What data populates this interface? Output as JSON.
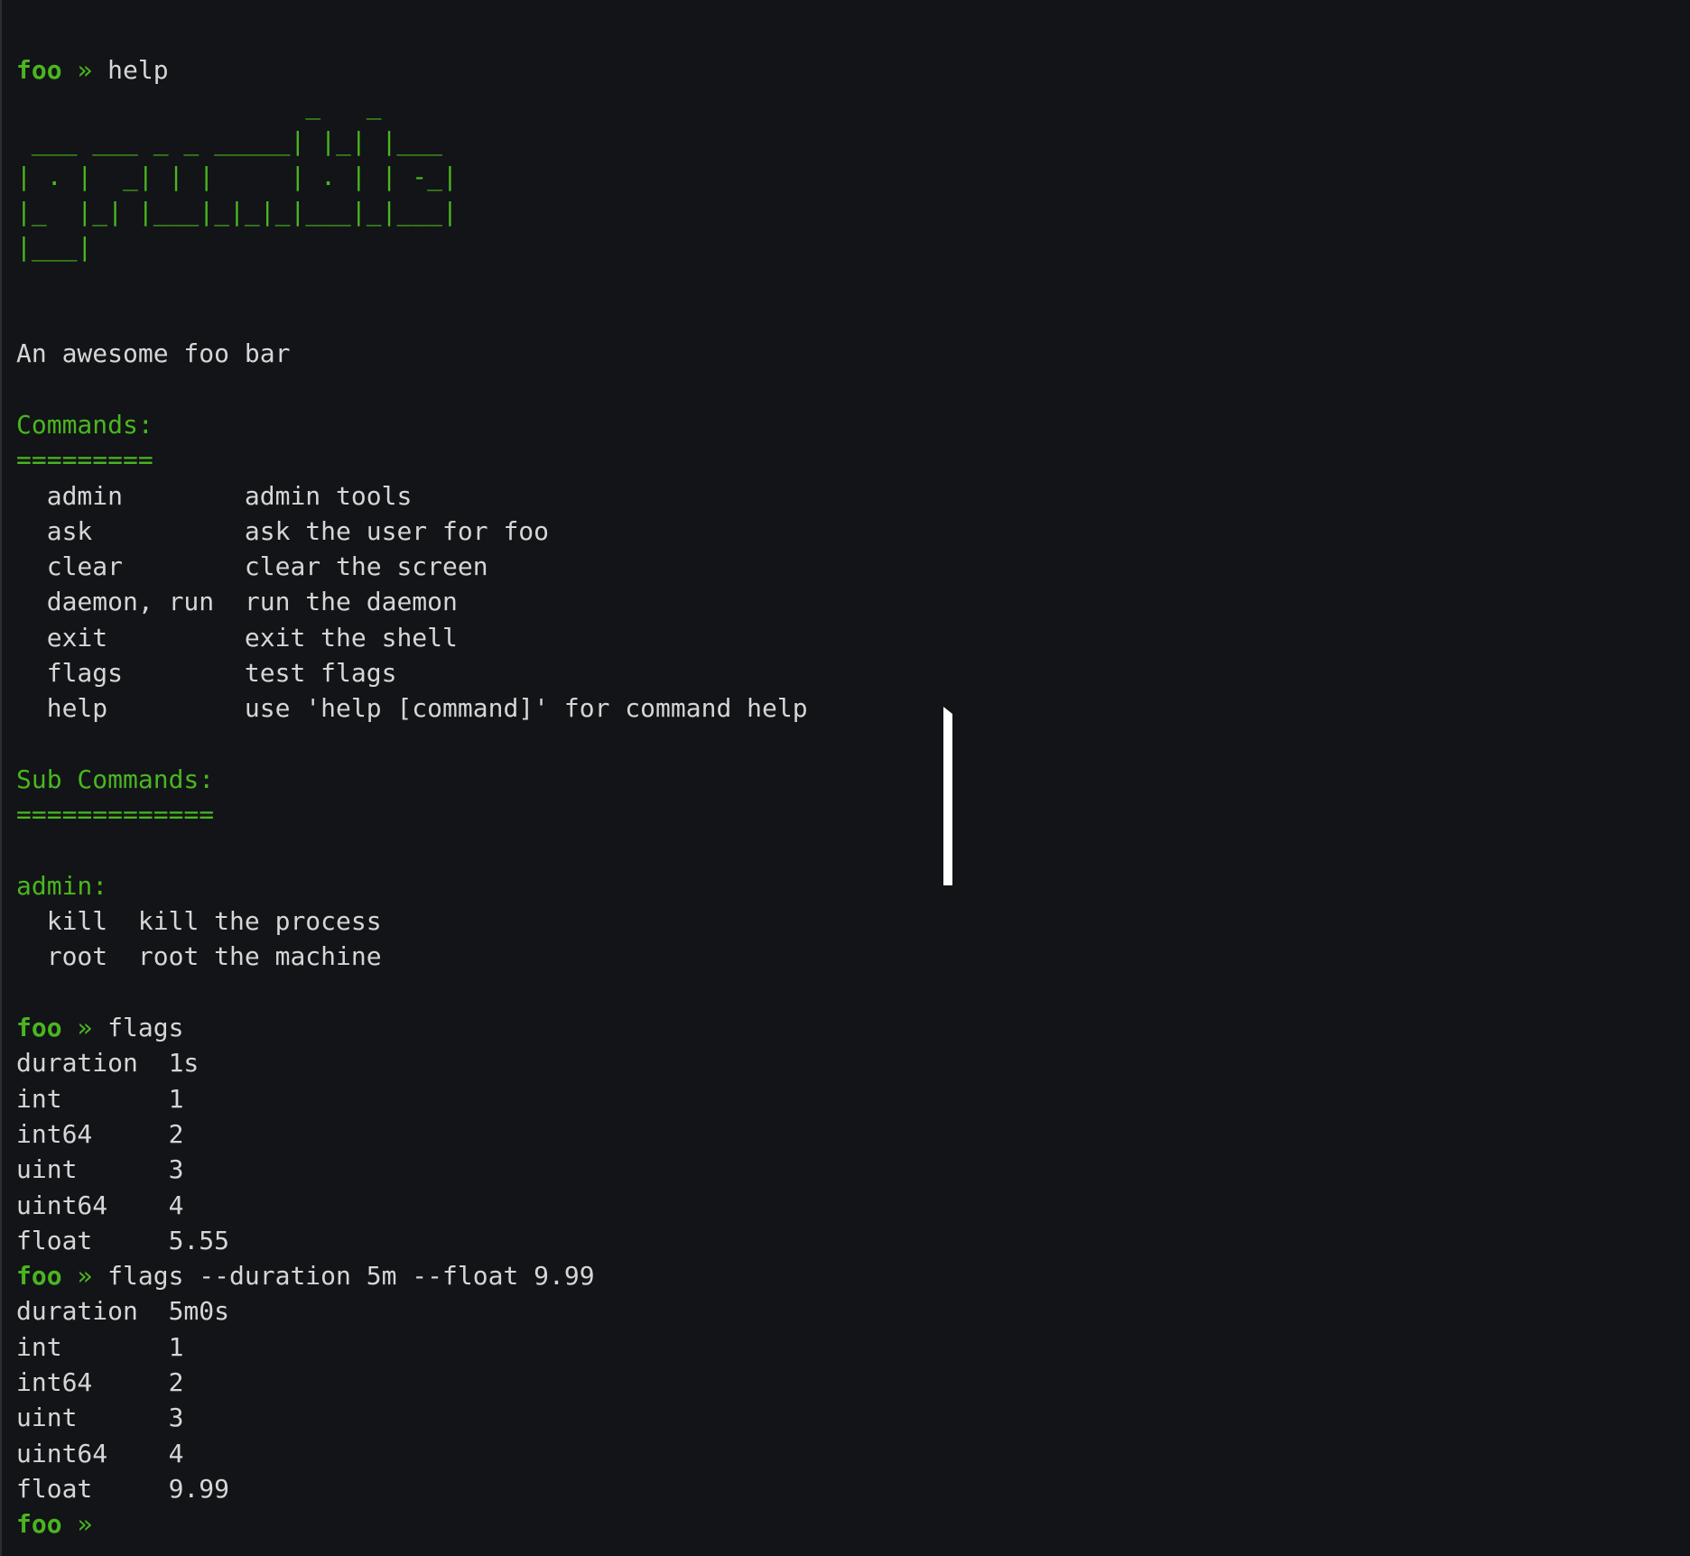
{
  "prompt": {
    "name": "foo",
    "symbol": "»"
  },
  "session1": {
    "command": "help",
    "banner": [
      "                   _   _",
      " ___ ___ _ _ _____| |_| |___",
      "| . |  _| | |     | . | | -_|",
      "|_  |_| |___|_|_|_|___|_|___|",
      "|___|"
    ],
    "description": "An awesome foo bar",
    "commands_heading": "Commands:",
    "commands_underline": "=========",
    "commands": [
      {
        "name": "admin",
        "desc": "admin tools"
      },
      {
        "name": "ask",
        "desc": "ask the user for foo"
      },
      {
        "name": "clear",
        "desc": "clear the screen"
      },
      {
        "name": "daemon, run",
        "desc": "run the daemon"
      },
      {
        "name": "exit",
        "desc": "exit the shell"
      },
      {
        "name": "flags",
        "desc": "test flags"
      },
      {
        "name": "help",
        "desc": "use 'help [command]' for command help"
      }
    ],
    "subcommands_heading": "Sub Commands:",
    "subcommands_underline": "=============",
    "admin_heading": "admin:",
    "admin_subcommands": [
      {
        "name": "kill",
        "desc": "kill the process"
      },
      {
        "name": "root",
        "desc": "root the machine"
      }
    ]
  },
  "session2": {
    "command": "flags",
    "flags": [
      {
        "name": "duration",
        "value": "1s"
      },
      {
        "name": "int",
        "value": "1"
      },
      {
        "name": "int64",
        "value": "2"
      },
      {
        "name": "uint",
        "value": "3"
      },
      {
        "name": "uint64",
        "value": "4"
      },
      {
        "name": "float",
        "value": "5.55"
      }
    ]
  },
  "session3": {
    "command": "flags --duration 5m --float 9.99",
    "flags": [
      {
        "name": "duration",
        "value": "5m0s"
      },
      {
        "name": "int",
        "value": "1"
      },
      {
        "name": "int64",
        "value": "2"
      },
      {
        "name": "uint",
        "value": "3"
      },
      {
        "name": "uint64",
        "value": "4"
      },
      {
        "name": "float",
        "value": "9.99"
      }
    ]
  },
  "colors": {
    "background": "#121417",
    "text": "#d6d6d6",
    "accent_green": "#4ab61f",
    "cursor": "#ffffff"
  }
}
